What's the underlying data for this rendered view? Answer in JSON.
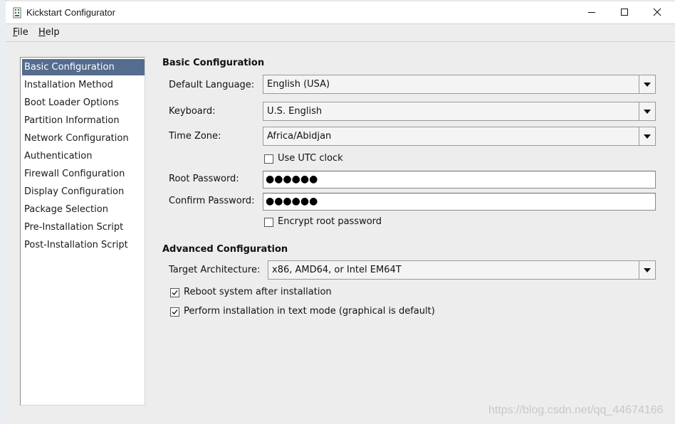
{
  "window": {
    "title": "Kickstart Configurator"
  },
  "menubar": {
    "file_label": "File",
    "file_mnemonic": "F",
    "file_rest": "ile",
    "help_label": "Help",
    "help_mnemonic": "H",
    "help_rest": "elp"
  },
  "sidebar": {
    "items": [
      {
        "label": "Basic Configuration",
        "selected": true
      },
      {
        "label": "Installation Method",
        "selected": false
      },
      {
        "label": "Boot Loader Options",
        "selected": false
      },
      {
        "label": "Partition Information",
        "selected": false
      },
      {
        "label": "Network Configuration",
        "selected": false
      },
      {
        "label": "Authentication",
        "selected": false
      },
      {
        "label": "Firewall Configuration",
        "selected": false
      },
      {
        "label": "Display Configuration",
        "selected": false
      },
      {
        "label": "Package Selection",
        "selected": false
      },
      {
        "label": "Pre-Installation Script",
        "selected": false
      },
      {
        "label": "Post-Installation Script",
        "selected": false
      }
    ]
  },
  "basic": {
    "heading": "Basic Configuration",
    "language_label": "Default Language:",
    "language_value": "English (USA)",
    "keyboard_label": "Keyboard:",
    "keyboard_value": "U.S. English",
    "timezone_label": "Time Zone:",
    "timezone_value": "Africa/Abidjan",
    "utc_label": "Use UTC clock",
    "utc_checked": false,
    "root_pw_label": "Root Password:",
    "root_pw_value": "●●●●●●",
    "confirm_pw_label": "Confirm Password:",
    "confirm_pw_value": "●●●●●●",
    "encrypt_label": "Encrypt root password",
    "encrypt_checked": false
  },
  "advanced": {
    "heading": "Advanced Configuration",
    "arch_label": "Target Architecture:",
    "arch_value": "x86, AMD64, or Intel EM64T",
    "reboot_label": "Reboot system after installation",
    "reboot_checked": true,
    "textmode_label": "Perform installation in text mode (graphical is default)",
    "textmode_checked": true
  },
  "watermark": "https://blog.csdn.net/qq_44674166",
  "colors": {
    "selection": "#546c8e",
    "window_bg": "#ededed"
  }
}
